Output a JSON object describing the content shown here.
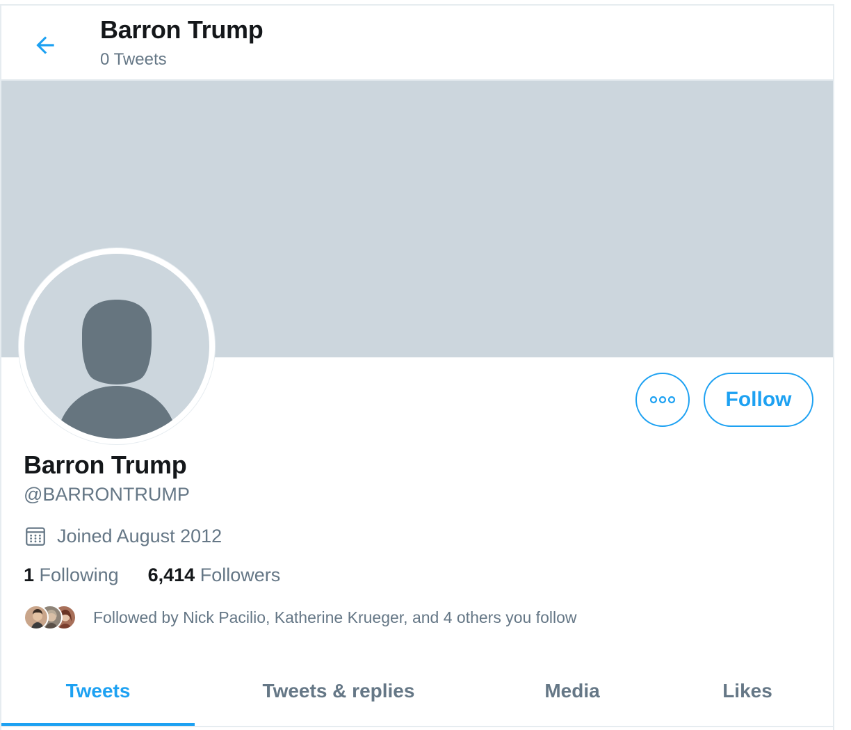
{
  "header": {
    "title": "Barron Trump",
    "subtitle": "0 Tweets"
  },
  "profile": {
    "display_name": "Barron Trump",
    "handle": "@BARRONTRUMP",
    "joined": "Joined August 2012",
    "following_count": "1",
    "following_label": "Following",
    "followers_count": "6,414",
    "followers_label": "Followers",
    "followed_by": "Followed by Nick Pacilio, Katherine Krueger, and 4 others you follow"
  },
  "actions": {
    "follow_label": "Follow"
  },
  "tabs": [
    {
      "label": "Tweets",
      "active": true
    },
    {
      "label": "Tweets & replies",
      "active": false
    },
    {
      "label": "Media",
      "active": false
    },
    {
      "label": "Likes",
      "active": false
    }
  ],
  "colors": {
    "accent": "#1da1f2",
    "banner": "#ccd6dd",
    "secondary_text": "#657786",
    "avatar_silhouette": "#66757f"
  },
  "icons": {
    "back": "arrow-left-icon",
    "more": "more-horizontal-icon",
    "calendar": "calendar-icon"
  }
}
